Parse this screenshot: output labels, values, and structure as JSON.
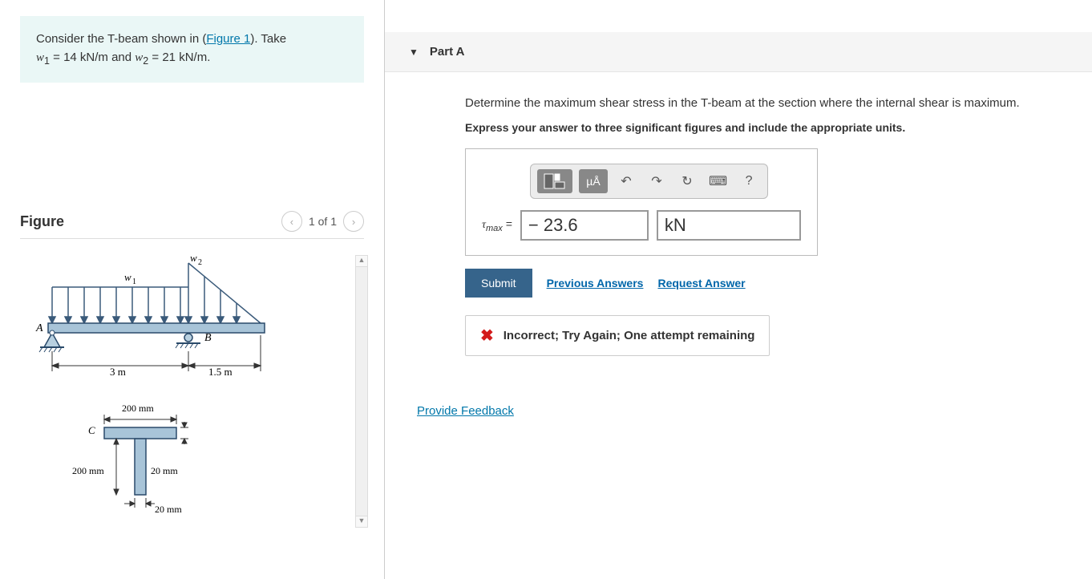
{
  "problem": {
    "prefix": "Consider the T-beam shown in (",
    "figure_link": "Figure 1",
    "suffix": "). Take",
    "line2_html": "w₁ = 14 kN/m and w₂ = 21 kN/m."
  },
  "figure": {
    "title": "Figure",
    "pager": "1 of 1",
    "labels": {
      "w1": "w₁",
      "w2": "w₂",
      "A": "A",
      "B": "B",
      "C": "C",
      "span1": "3 m",
      "span2": "1.5 m",
      "flange_w": "200 mm",
      "web_h": "200 mm",
      "flange_t": "20 mm",
      "web_t": "20 mm"
    }
  },
  "part": {
    "label": "Part A",
    "instruction": "Determine the maximum shear stress in the T-beam at the section where the internal shear is maximum.",
    "units_instruction": "Express your answer to three significant figures and include the appropriate units.",
    "toolbar": {
      "mu": "µÅ",
      "help": "?"
    },
    "answer": {
      "var_html": "τmax =",
      "value": "− 23.6",
      "units": "kN"
    },
    "submit": "Submit",
    "prev_answers": "Previous Answers",
    "request_answer": "Request Answer",
    "feedback": "Incorrect; Try Again; One attempt remaining"
  },
  "provide_feedback": "Provide Feedback"
}
